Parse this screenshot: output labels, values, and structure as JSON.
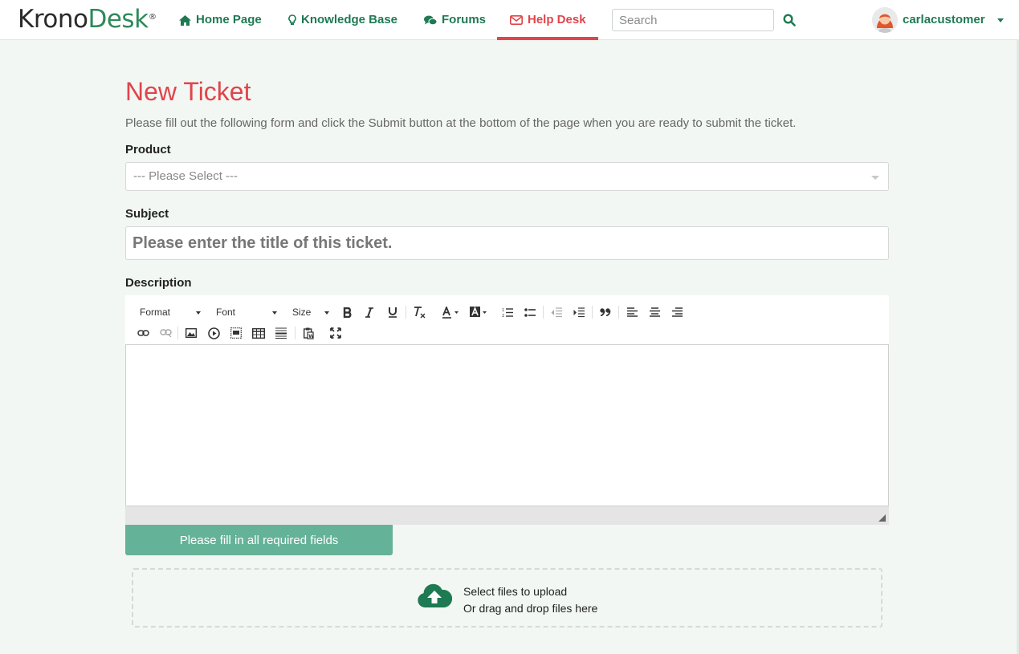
{
  "brand": {
    "logo_part1": "Krono",
    "logo_part2": "Desk",
    "logo_mark": "®"
  },
  "nav": {
    "items": [
      {
        "label": "Home Page",
        "icon": "home-icon"
      },
      {
        "label": "Knowledge Base",
        "icon": "lightbulb-icon"
      },
      {
        "label": "Forums",
        "icon": "comments-icon"
      },
      {
        "label": "Help Desk",
        "icon": "envelope-icon",
        "active": true
      }
    ],
    "search_placeholder": "Search",
    "user": {
      "name": "carlacustomer"
    }
  },
  "page": {
    "title": "New Ticket",
    "intro": "Please fill out the following form and click the Submit button at the bottom of the page when you are ready to submit the ticket."
  },
  "form": {
    "product_label": "Product",
    "product_value": "--- Please Select ---",
    "subject_label": "Subject",
    "subject_placeholder": "Please enter the title of this ticket.",
    "description_label": "Description",
    "toolbar": {
      "format": "Format",
      "font": "Font",
      "size": "Size"
    },
    "submit_label": "Please fill in all required fields"
  },
  "upload": {
    "line1": "Select files to upload",
    "line2": "Or drag and drop files here"
  },
  "colors": {
    "accent_green": "#1e7a52",
    "accent_red": "#e0454b",
    "submit_bg": "#64b297"
  }
}
